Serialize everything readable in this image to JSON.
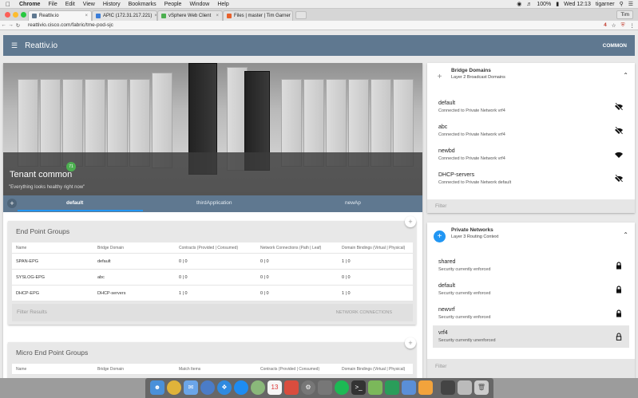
{
  "os_menu": {
    "app": "Chrome",
    "items": [
      "File",
      "Edit",
      "View",
      "History",
      "Bookmarks",
      "People",
      "Window",
      "Help"
    ],
    "battery": "100%",
    "clock": "Wed 12:13",
    "user": "tigarner"
  },
  "browser": {
    "tabs": [
      {
        "title": "Reattiv.io",
        "favicon_color": "#5f7890",
        "active": true
      },
      {
        "title": "APIC (172.31.217.221)",
        "favicon_color": "#3b7dd8",
        "active": false
      },
      {
        "title": "vSphere Web Client",
        "favicon_color": "#4caf50",
        "active": false
      },
      {
        "title": "Files | master | Tim Garner",
        "favicon_color": "#e8612c",
        "active": false
      }
    ],
    "profile": "Tim",
    "url": "reattivio.cisco.com/fabric/tme-pod-sjc",
    "ext_count": "4"
  },
  "app": {
    "title": "Reattiv.io",
    "context": "COMMON"
  },
  "tenant": {
    "name": "Tenant common",
    "badge": "71",
    "status": "\"Everything looks healthy right now\""
  },
  "app_tabs": [
    "default",
    "thirdApplication",
    "newAp"
  ],
  "epg": {
    "title": "End Point Groups",
    "columns": [
      "Name",
      "Bridge Domain",
      "Contracts (Provided | Consumed)",
      "Network Connections (Path | Leaf)",
      "Domain Bindings (Virtual | Physical)"
    ],
    "rows": [
      [
        "SPAN-EPG",
        "default",
        "0 | 0",
        "0 | 0",
        "1 | 0"
      ],
      [
        "SYSLOG-EPG",
        "abc",
        "0 | 0",
        "0 | 0",
        "0 | 0"
      ],
      [
        "DHCP-EPG",
        "DHCP-servers",
        "1 | 0",
        "0 | 0",
        "1 | 0"
      ]
    ],
    "filter": "Filter Results",
    "action": "NETWORK CONNECTIONS"
  },
  "uepg": {
    "title": "Micro End Point Groups",
    "columns": [
      "Name",
      "Bridge Domain",
      "Match Items",
      "Contracts (Provided | Consumed)",
      "Domain Bindings (Virtual | Physical)"
    ]
  },
  "bridge_domains": {
    "title": "Bridge Domains",
    "subtitle": "Layer 2 Broadcast Domains",
    "items": [
      {
        "name": "default",
        "desc": "Connected to Private Network vrf4",
        "icon": "wifi-off-icon"
      },
      {
        "name": "abc",
        "desc": "Connected to Private Network vrf4",
        "icon": "wifi-off-icon"
      },
      {
        "name": "newbd",
        "desc": "Connected to Private Network vrf4",
        "icon": "wifi-icon"
      },
      {
        "name": "DHCP-servers",
        "desc": "Connected to Private Network default",
        "icon": "wifi-off-icon"
      }
    ],
    "filter": "Filter"
  },
  "private_networks": {
    "title": "Private Networks",
    "subtitle": "Layer 3 Routing Context",
    "items": [
      {
        "name": "shared",
        "desc": "Security currently enforced",
        "icon": "lock-icon"
      },
      {
        "name": "default",
        "desc": "Security currently enforced",
        "icon": "lock-icon"
      },
      {
        "name": "newvrf",
        "desc": "Security currently enforced",
        "icon": "lock-icon"
      },
      {
        "name": "vrf4",
        "desc": "Security currently unenforced",
        "icon": "lock-open-icon"
      }
    ],
    "filter": "Filter"
  },
  "colors": {
    "appbar": "#5f7890",
    "accent": "#2196f3",
    "badge": "#4caf50"
  }
}
